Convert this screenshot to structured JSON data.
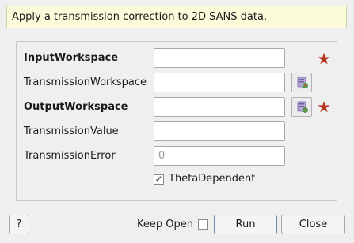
{
  "description": "Apply a transmission correction to 2D SANS data.",
  "fields": [
    {
      "label": "InputWorkspace",
      "value": "",
      "required": true,
      "bold": true,
      "browse": false
    },
    {
      "label": "TransmissionWorkspace",
      "value": "",
      "required": false,
      "bold": false,
      "browse": true
    },
    {
      "label": "OutputWorkspace",
      "value": "",
      "required": true,
      "bold": true,
      "browse": true
    },
    {
      "label": "TransmissionValue",
      "value": "",
      "required": false,
      "bold": false,
      "browse": false
    },
    {
      "label": "TransmissionError",
      "value": "0",
      "required": false,
      "bold": false,
      "browse": false
    }
  ],
  "theta_dependent": {
    "label": "ThetaDependent",
    "checked": true,
    "mark": "✓"
  },
  "footer": {
    "help_label": "?",
    "keep_open_label": "Keep Open",
    "keep_open_checked": false,
    "run_label": "Run",
    "close_label": "Close"
  },
  "colors": {
    "required_star": "#b5341f",
    "description_bg": "#fbfbda"
  },
  "icons": {
    "browse": "workspace-browse-icon",
    "required": "required-star-icon"
  }
}
